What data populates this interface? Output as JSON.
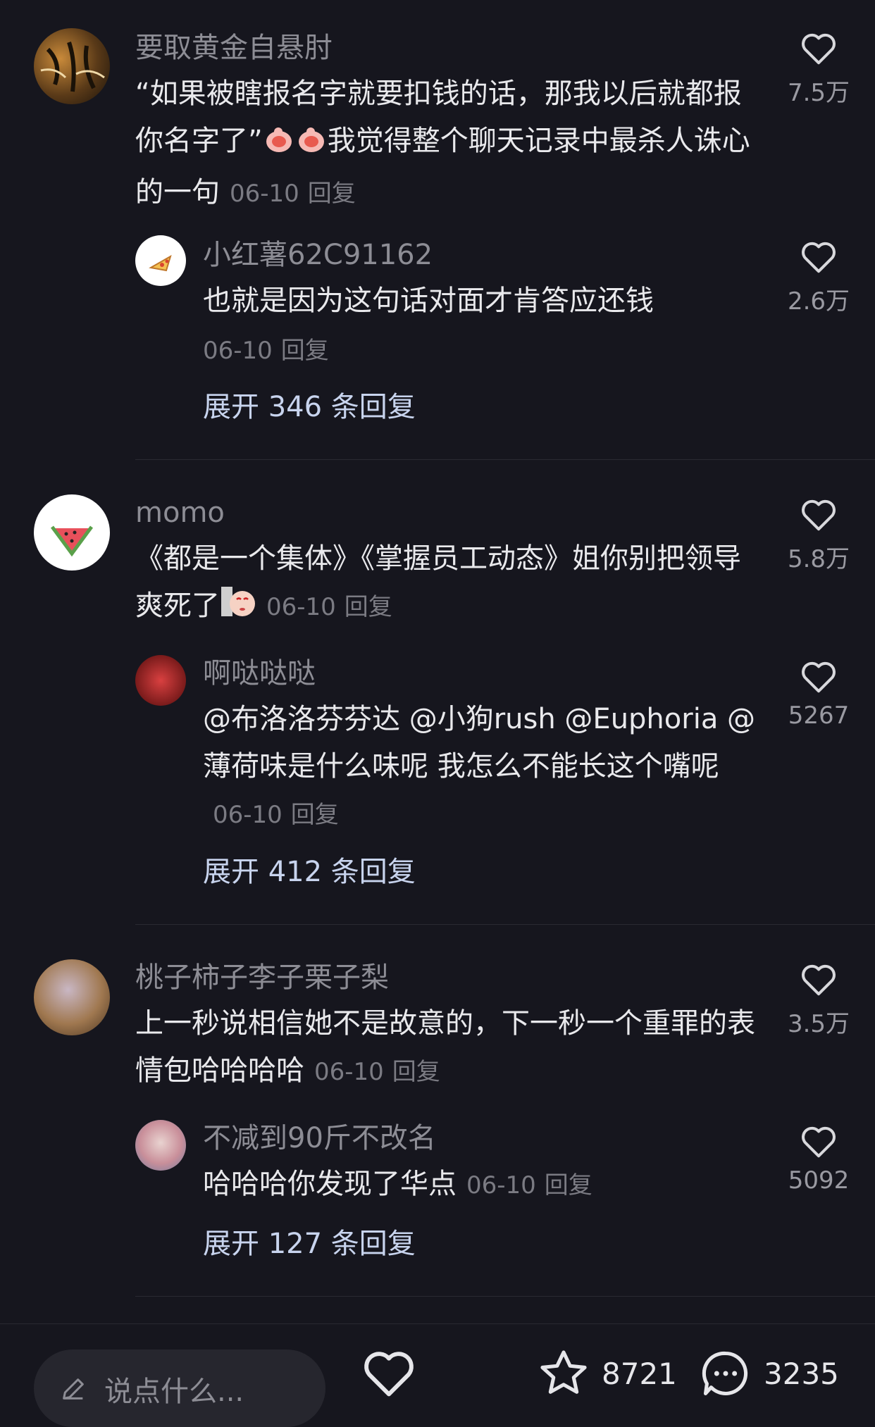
{
  "comments": [
    {
      "user": "要取黄金自悬肘",
      "text": "“如果被瞎报名字就要扣钱的话，那我以后就都报你名字了”",
      "text2": "我觉得整个聊天记录中最杀人诛心的一句",
      "date": "06-10",
      "reply_label": "回复",
      "likes": "7.5万",
      "replies": [
        {
          "user": "小红薯62C91162",
          "text": "也就是因为这句话对面才肯答应还钱",
          "date": "06-10",
          "reply_label": "回复",
          "likes": "2.6万"
        }
      ],
      "expand": "展开 346 条回复"
    },
    {
      "user": "momo",
      "text": "《都是一个集体》《掌握员工动态》姐你别把领导爽死了",
      "date": "06-10",
      "reply_label": "回复",
      "likes": "5.8万",
      "replies": [
        {
          "user": "啊哒哒哒",
          "text": "@布洛洛芬芬达 @小狗rush @Euphoria @薄荷味是什么味呢 我怎么不能长这个嘴呢",
          "date": "06-10",
          "reply_label": "回复",
          "likes": "5267"
        }
      ],
      "expand": "展开 412 条回复"
    },
    {
      "user": "桃子柿子李子栗子梨",
      "text": "上一秒说相信她不是故意的，下一秒一个重罪的表情包哈哈哈哈",
      "date": "06-10",
      "reply_label": "回复",
      "likes": "3.5万",
      "replies": [
        {
          "user": "不减到90斤不改名",
          "text": "哈哈哈你发现了华点",
          "date": "06-10",
          "reply_label": "回复",
          "likes": "5092"
        }
      ],
      "expand": "展开 127 条回复"
    }
  ],
  "bottom_bar": {
    "input_placeholder": "说点什么...",
    "favorites": "8721",
    "comments": "3235"
  },
  "icons": {
    "like": "heart-outline-icon",
    "pen": "pencil-icon",
    "star": "star-outline-icon",
    "chat": "chat-bubble-icon"
  },
  "colors": {
    "background": "#16161e",
    "username": "#8d8d95",
    "expand_link": "#c8d4ee"
  }
}
